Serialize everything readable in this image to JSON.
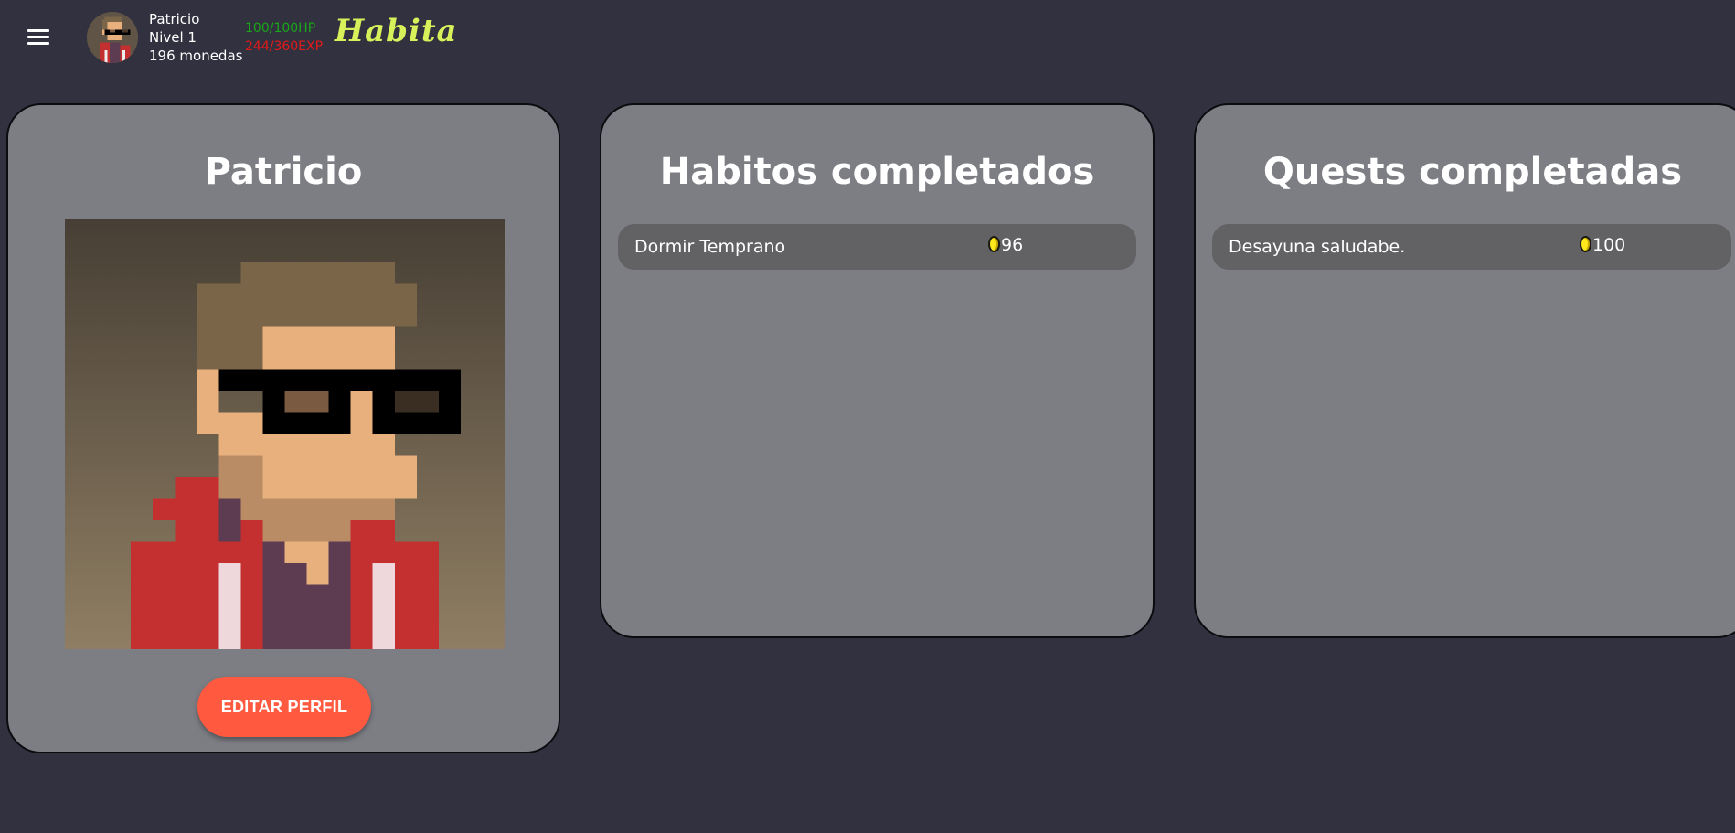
{
  "header": {
    "menu_icon": "hamburger-menu-icon",
    "user_name": "Patricio",
    "level": "Nivel 1",
    "coins": "196 monedas",
    "hp": "100/100HP",
    "exp": "244/360EXP",
    "logo": "Habita"
  },
  "profile": {
    "name": "Patricio",
    "edit_button": "EDITAR PERFIL"
  },
  "habits": {
    "title": "Habitos completados",
    "items": [
      {
        "label": "Dormir Temprano",
        "reward": "96"
      }
    ]
  },
  "quests": {
    "title": "Quests completadas",
    "items": [
      {
        "label": "Desayuna saludabe.",
        "reward": "100"
      }
    ]
  },
  "colors": {
    "background": "#32313f",
    "card": "#7d7e84",
    "list_item": "#626265",
    "button": "#ff5a40",
    "hp": "#18a818",
    "exp": "#e01b1b",
    "logo": "#d8f05a",
    "coin": "#ffe81c"
  }
}
